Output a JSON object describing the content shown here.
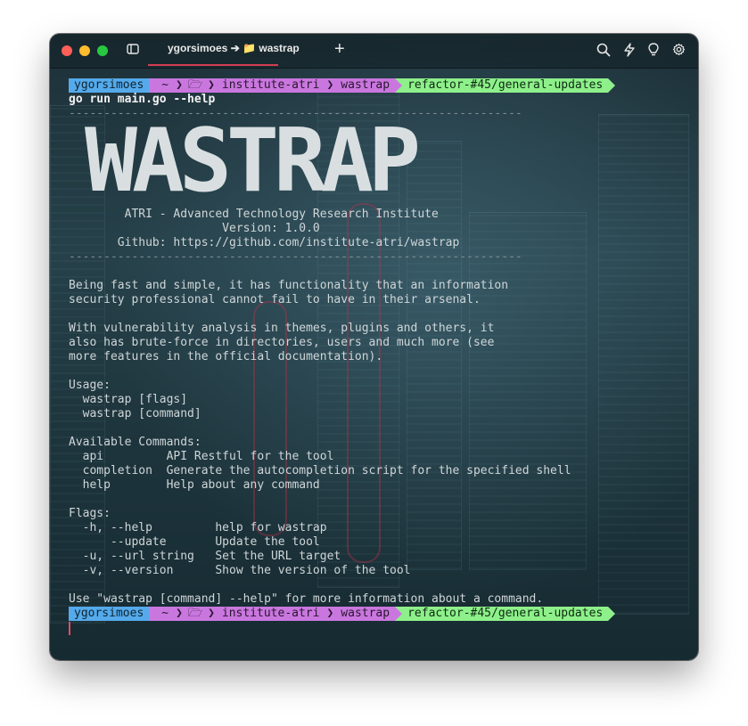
{
  "window": {
    "tab_title": "ygorsimoes ➔ 📁 wastrap",
    "new_tab_label": "+",
    "icons": [
      "sidebar-icon",
      "search-icon",
      "bolt-icon",
      "lightbulb-icon",
      "gear-icon"
    ]
  },
  "prompt": {
    "user": "ygorsimoes",
    "home": "~",
    "folder_icon": "🗁",
    "dir1": "institute-atri",
    "dir2": "wastrap",
    "branch": "refactor-#45/general-updates",
    "colors": {
      "user": "#54aaeb",
      "path": "#c977de",
      "git": "#8ef08a"
    }
  },
  "command": "go run main.go --help",
  "output": {
    "separator": "-----------------------------------------------------------------",
    "logo_text": "WASTRAP",
    "org_line": "        ATRI - Advanced Technology Research Institute",
    "version_line": "                      Version: 1.0.0",
    "github_line": "       Github: https://github.com/institute-atri/wastrap",
    "desc1": "Being fast and simple, it has functionality that an information",
    "desc2": "security professional cannot fail to have in their arsenal.",
    "desc3": "With vulnerability analysis in themes, plugins and others, it",
    "desc4": "also has brute-force in directories, users and much more (see",
    "desc5": "more features in the official documentation).",
    "usage_header": "Usage:",
    "usage1": "  wastrap [flags]",
    "usage2": "  wastrap [command]",
    "commands_header": "Available Commands:",
    "cmd_api": "  api         API Restful for the tool",
    "cmd_completion": "  completion  Generate the autocompletion script for the specified shell",
    "cmd_help": "  help        Help about any command",
    "flags_header": "Flags:",
    "flag_help": "  -h, --help         help for wastrap",
    "flag_update": "      --update       Update the tool",
    "flag_url": "  -u, --url string   Set the URL target",
    "flag_version": "  -v, --version      Show the version of the tool",
    "footer": "Use \"wastrap [command] --help\" for more information about a command."
  }
}
